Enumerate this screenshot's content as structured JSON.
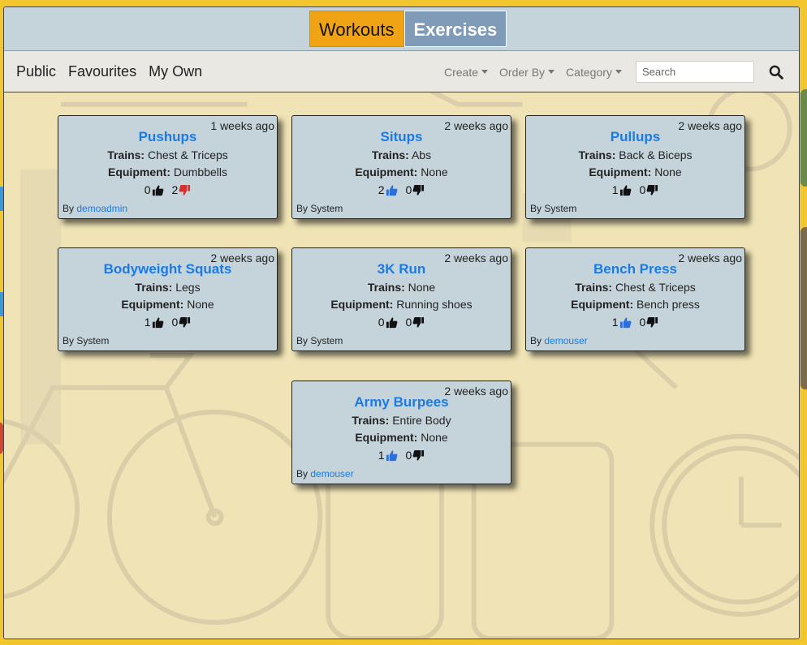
{
  "tabs": [
    {
      "label": "Workouts",
      "active": true
    },
    {
      "label": "Exercises",
      "active": false
    }
  ],
  "subnav": [
    "Public",
    "Favourites",
    "My Own"
  ],
  "dropdowns": [
    "Create",
    "Order By",
    "Category"
  ],
  "search": {
    "placeholder": "Search",
    "icon": "search-icon"
  },
  "labels": {
    "trains": "Trains:",
    "equipment": "Equipment:",
    "by": "By "
  },
  "colors": {
    "accent": "#f0a315",
    "link": "#1a7be6",
    "upvote_active": "#2a6fdb",
    "downvote_active": "#d9302c"
  },
  "cards": [
    {
      "time": "1 weeks ago",
      "title": "Pushups",
      "trains": "Chest & Triceps",
      "equipment": "Dumbbells",
      "up": "0",
      "down": "2",
      "up_state": "neutral",
      "down_state": "active",
      "author": "demoadmin",
      "author_is_link": true
    },
    {
      "time": "2 weeks ago",
      "title": "Situps",
      "trains": "Abs",
      "equipment": "None",
      "up": "2",
      "down": "0",
      "up_state": "active",
      "down_state": "neutral",
      "author": "System",
      "author_is_link": false
    },
    {
      "time": "2 weeks ago",
      "title": "Pullups",
      "trains": "Back & Biceps",
      "equipment": "None",
      "up": "1",
      "down": "0",
      "up_state": "neutral",
      "down_state": "neutral",
      "author": "System",
      "author_is_link": false
    },
    {
      "time": "2 weeks ago",
      "title": "Bodyweight Squats",
      "trains": "Legs",
      "equipment": "None",
      "up": "1",
      "down": "0",
      "up_state": "neutral",
      "down_state": "neutral",
      "author": "System",
      "author_is_link": false
    },
    {
      "time": "2 weeks ago",
      "title": "3K Run",
      "trains": "None",
      "equipment": "Running shoes",
      "up": "0",
      "down": "0",
      "up_state": "neutral",
      "down_state": "neutral",
      "author": "System",
      "author_is_link": false
    },
    {
      "time": "2 weeks ago",
      "title": "Bench Press",
      "trains": "Chest & Triceps",
      "equipment": "Bench press",
      "up": "1",
      "down": "0",
      "up_state": "active",
      "down_state": "neutral",
      "author": "demouser",
      "author_is_link": true
    },
    {
      "time": "2 weeks ago",
      "title": "Army Burpees",
      "trains": "Entire Body",
      "equipment": "None",
      "up": "1",
      "down": "0",
      "up_state": "active",
      "down_state": "neutral",
      "author": "demouser",
      "author_is_link": true
    }
  ]
}
